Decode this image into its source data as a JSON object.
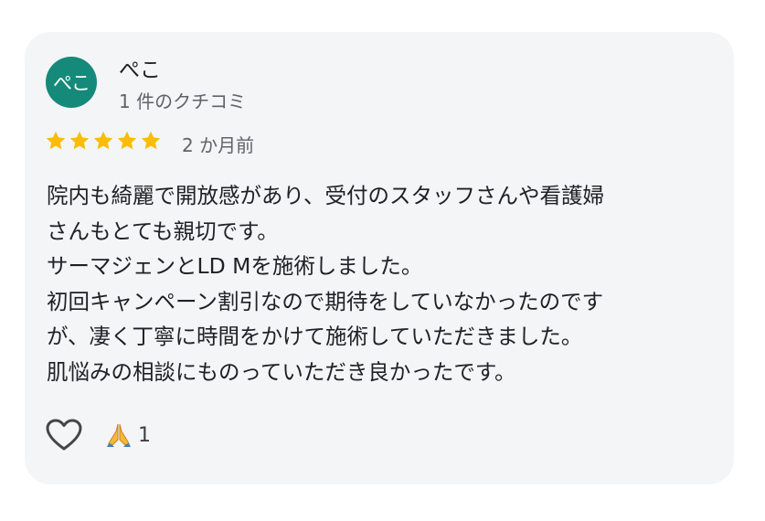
{
  "review": {
    "author": {
      "initials": "ぺこ",
      "name": "ぺこ",
      "review_count": "1 件のクチコミ",
      "avatar_color": "#158a7a"
    },
    "rating": {
      "stars": 5,
      "max": 5,
      "star_color": "#fbbc04"
    },
    "time_ago": "2 か月前",
    "text_lines": [
      "院内も綺麗で開放感があり、受付のスタッフさんや看護婦",
      "さんもとても親切です。",
      "サーマジェンとLD Mを施術しました。",
      "初回キャンペーン割引なので期待をしていなかったのです",
      "が、凄く丁寧に時間をかけて施術していただきました。",
      "肌悩みの相談にものっていただき良かったです。"
    ],
    "actions": {
      "like_icon": "heart-outline-icon",
      "reaction_icon": "folded-hands-emoji",
      "reaction_count": "1"
    }
  }
}
